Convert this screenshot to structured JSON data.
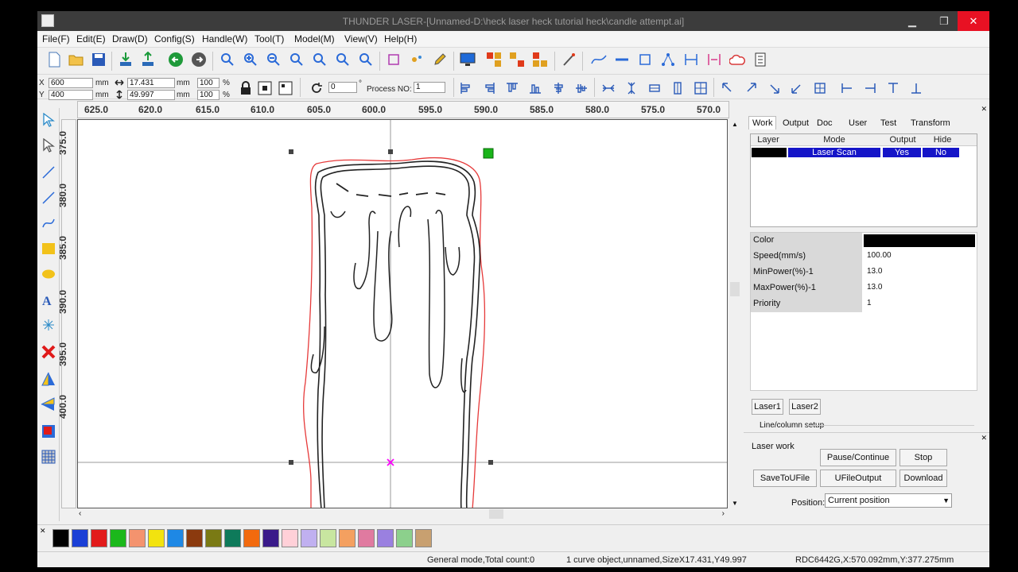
{
  "window": {
    "title": "THUNDER LASER-[Unnamed-D:\\heck laser heck tutorial heck\\candle attempt.ai]",
    "close_glyph": "✕"
  },
  "menu": [
    "File(F)",
    "Edit(E)",
    "Draw(D)",
    "Config(S)",
    "Handle(W)",
    "Tool(T)",
    "Model(M)",
    "View(V)",
    "Help(H)"
  ],
  "props_toolbar": {
    "x_label": "X",
    "y_label": "Y",
    "x_value": "600",
    "y_value": "400",
    "unit": "mm",
    "width_value": "17.431",
    "height_value": "49.997",
    "scale_w": "100",
    "scale_h": "100",
    "percent": "%",
    "rotate_value": "0",
    "degree": "°",
    "process_label": "Process NO:",
    "process_value": "1"
  },
  "ruler_h": [
    "625.0",
    "620.0",
    "615.0",
    "610.0",
    "605.0",
    "600.0",
    "595.0",
    "590.0",
    "585.0",
    "580.0",
    "575.0",
    "570.0"
  ],
  "ruler_v": [
    "375.0",
    "380.0",
    "385.0",
    "390.0",
    "395.0",
    "400.0"
  ],
  "tabs": [
    "Work",
    "Output",
    "Doc",
    "User",
    "Test",
    "Transform"
  ],
  "layer_table": {
    "headers": [
      "Layer",
      "Mode",
      "Output",
      "Hide"
    ],
    "rows": [
      {
        "color": "#000000",
        "mode": "Laser Scan",
        "output": "Yes",
        "hide": "No"
      }
    ]
  },
  "properties": [
    {
      "name": "Color",
      "value": "",
      "swatch": "#000000"
    },
    {
      "name": "Speed(mm/s)",
      "value": "100.00"
    },
    {
      "name": "MinPower(%)-1",
      "value": "13.0"
    },
    {
      "name": "MaxPower(%)-1",
      "value": "13.0"
    },
    {
      "name": "Priority",
      "value": "1"
    }
  ],
  "laser_tabs": [
    "Laser1",
    "Laser2"
  ],
  "line_column_setup": "Line/column setup",
  "laser_work": {
    "title": "Laser work",
    "pause": "Pause/Continue",
    "stop": "Stop",
    "save_to_ufile": "SaveToUFile",
    "ufile_output": "UFileOutput",
    "download": "Download",
    "position_label": "Position:",
    "position_value": "Current position"
  },
  "palette": [
    "#000000",
    "#1a3fd6",
    "#e21b1b",
    "#1bb81b",
    "#f4936e",
    "#f2e30f",
    "#1e88e5",
    "#8b3a0e",
    "#7a7a14",
    "#0e7a5a",
    "#f26a0e",
    "#3a1a8a",
    "#ffd0d8",
    "#c0b0f0",
    "#c8e6a0",
    "#f4a060",
    "#e07aa0",
    "#9a80e0",
    "#8cd08c",
    "#c8a070"
  ],
  "status": {
    "mode": "General mode,Total count:0",
    "selection": "1 curve object,unnamed,SizeX17.431,Y49.997",
    "coords": "RDC6442G,X:570.092mm,Y:377.275mm"
  },
  "colors": {
    "accent": "#1515c8",
    "outline_red": "#e63a3a",
    "handle_green": "#19b419",
    "center_mark": "#ff00ff"
  }
}
